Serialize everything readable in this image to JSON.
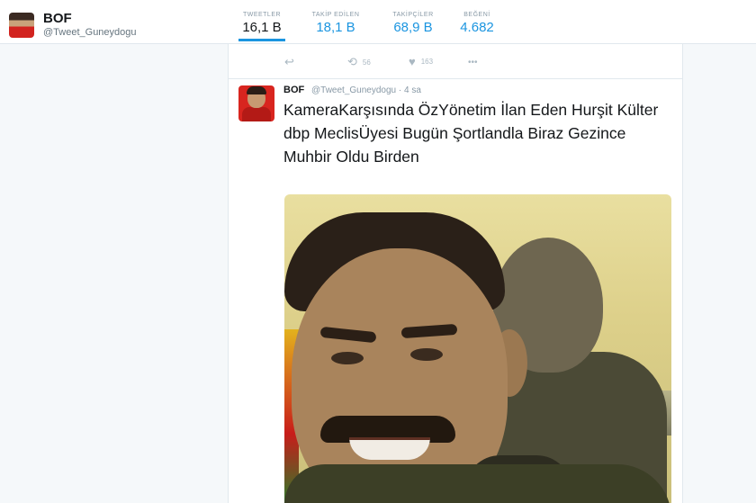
{
  "profile": {
    "name": "BOF",
    "handle": "@Tweet_Guneydogu"
  },
  "stats": [
    {
      "label": "TWEETLER",
      "value": "16,1 B"
    },
    {
      "label": "TAKİP EDİLEN",
      "value": "18,1 B"
    },
    {
      "label": "TAKİPÇİLER",
      "value": "68,9 B"
    },
    {
      "label": "BEĞENİ",
      "value": "4.682"
    }
  ],
  "actions": {
    "reply_icon": "↩",
    "retweet_icon": "⟲",
    "retweet_count": "56",
    "like_icon": "♥",
    "like_count": "163",
    "more_icon": "•••"
  },
  "tweet": {
    "name": "BOF",
    "handle": "@Tweet_Guneydogu · 4 sa",
    "text": "KameraKarşısında ÖzYönetim İlan Eden Hurşit Külter dbp MeclisÜyesi Bugün Şortlandla Biraz Gezince Muhbir Oldu Birden"
  },
  "colors": {
    "accent": "#1b95e0",
    "background": "#f5f8fa"
  }
}
